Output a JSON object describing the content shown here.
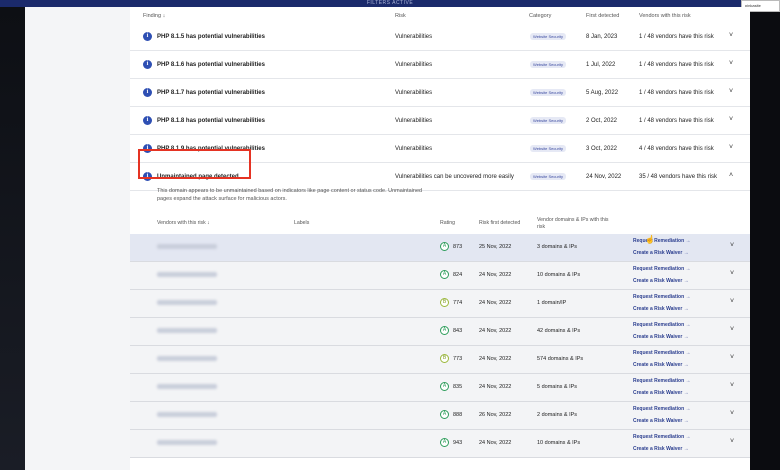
{
  "banner": "FILTERS ACTIVE",
  "filter_input": "pinkasite",
  "headers": {
    "finding": "Finding ↓",
    "risk": "Risk",
    "category": "Category",
    "first_detected": "First detected",
    "vendors": "Vendors with this risk"
  },
  "findings": [
    {
      "title": "PHP 8.1.5 has potential vulnerabilities",
      "risk": "Vulnerabilities",
      "category": "Website Security",
      "date": "8 Jan, 2023",
      "vendors": "1 / 48 vendors have this risk",
      "chevron": "˅"
    },
    {
      "title": "PHP 8.1.6 has potential vulnerabilities",
      "risk": "Vulnerabilities",
      "category": "Website Security",
      "date": "1 Jul, 2022",
      "vendors": "1 / 48 vendors have this risk",
      "chevron": "˅"
    },
    {
      "title": "PHP 8.1.7 has potential vulnerabilities",
      "risk": "Vulnerabilities",
      "category": "Website Security",
      "date": "5 Aug, 2022",
      "vendors": "1 / 48 vendors have this risk",
      "chevron": "˅"
    },
    {
      "title": "PHP 8.1.8 has potential vulnerabilities",
      "risk": "Vulnerabilities",
      "category": "Website Security",
      "date": "2 Oct, 2022",
      "vendors": "1 / 48 vendors have this risk",
      "chevron": "˅"
    },
    {
      "title": "PHP 8.1.9 has potential vulnerabilities",
      "risk": "Vulnerabilities",
      "category": "Website Security",
      "date": "3 Oct, 2022",
      "vendors": "4 / 48 vendors have this risk",
      "chevron": "˅"
    },
    {
      "title": "Unmaintained page detected",
      "risk": "Vulnerabilities can be uncovered more easily",
      "category": "Website Security",
      "date": "24 Nov, 2022",
      "vendors": "35 / 48 vendors have this risk",
      "chevron": "˄"
    }
  ],
  "expanded": {
    "description_1": "This domain appears to be unmaintained based on indicators like page content or status code. Unmaintained",
    "description_2": "pages expand the attack surface for malicious actors.",
    "headers": {
      "vendors": "Vendors with this risk ↓",
      "labels": "Labels",
      "rating": "Rating",
      "risk_first_detected": "Risk first detected",
      "domains_1": "Vendor domains & IPs with this",
      "domains_2": "risk"
    },
    "request_label": "Request Remediation →",
    "waiver_label": "Create a Risk Waiver →",
    "rows": [
      {
        "grade": "A",
        "score": "873",
        "date": "25 Nov, 2022",
        "domains": "3 domains & IPs"
      },
      {
        "grade": "A",
        "score": "824",
        "date": "24 Nov, 2022",
        "domains": "10 domains & IPs"
      },
      {
        "grade": "B",
        "score": "774",
        "date": "24 Nov, 2022",
        "domains": "1 domain/IP"
      },
      {
        "grade": "A",
        "score": "843",
        "date": "24 Nov, 2022",
        "domains": "42 domains & IPs"
      },
      {
        "grade": "B",
        "score": "773",
        "date": "24 Nov, 2022",
        "domains": "574 domains & IPs"
      },
      {
        "grade": "A",
        "score": "835",
        "date": "24 Nov, 2022",
        "domains": "5 domains & IPs"
      },
      {
        "grade": "A",
        "score": "888",
        "date": "26 Nov, 2022",
        "domains": "2 domains & IPs"
      },
      {
        "grade": "A",
        "score": "943",
        "date": "24 Nov, 2022",
        "domains": "10 domains & IPs"
      }
    ]
  },
  "colors": {
    "accent": "#2e4fb3",
    "highlight": "#e53323",
    "grade_a": "#2e9d5b"
  }
}
